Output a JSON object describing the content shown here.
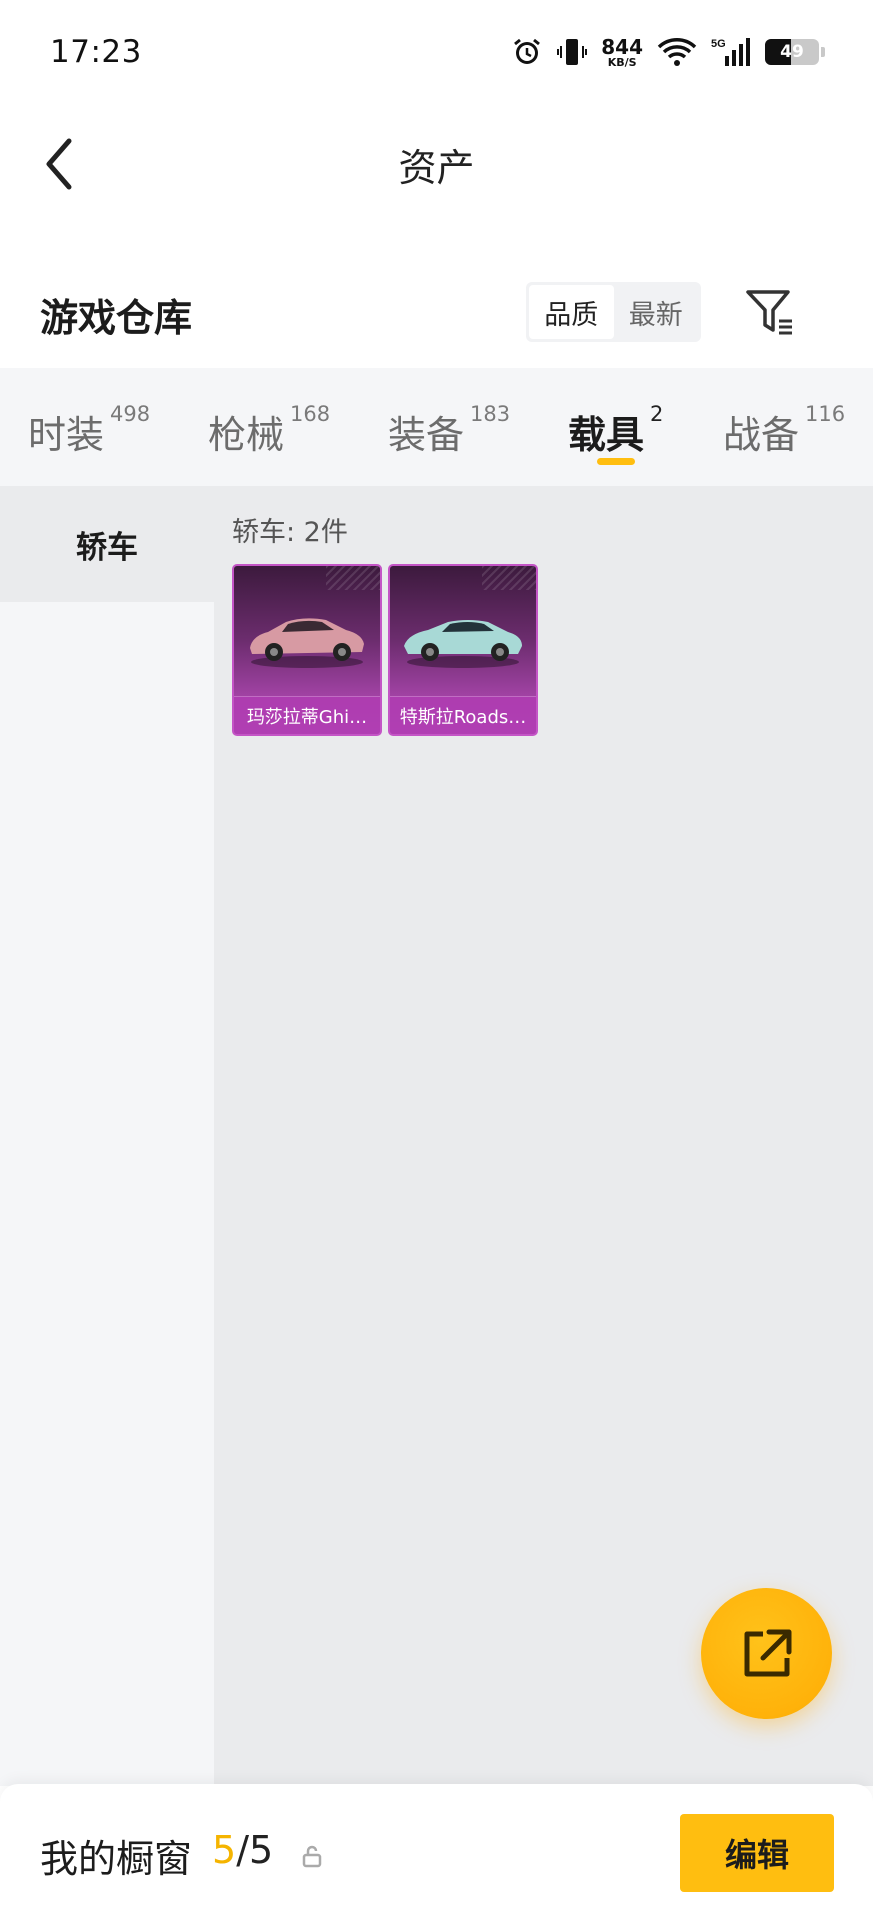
{
  "status_bar": {
    "time": "17:23",
    "net_speed": "844",
    "net_unit": "KB/S",
    "signal_label": "5G",
    "battery": 49,
    "battery_label": "49"
  },
  "header": {
    "title": "资产"
  },
  "warehouse": {
    "title": "游戏仓库",
    "sort_options": [
      {
        "label": "品质",
        "active": true
      },
      {
        "label": "最新",
        "active": false
      }
    ]
  },
  "tabs": [
    {
      "label": "时装",
      "count": "498",
      "active": false
    },
    {
      "label": "枪械",
      "count": "168",
      "active": false
    },
    {
      "label": "装备",
      "count": "183",
      "active": false
    },
    {
      "label": "载具",
      "count": "2",
      "active": true
    },
    {
      "label": "战备",
      "count": "116",
      "active": false
    }
  ],
  "sidebar": {
    "items": [
      {
        "label": "轿车",
        "active": true
      }
    ]
  },
  "main": {
    "section_label": "轿车: 2件",
    "items": [
      {
        "name": "玛莎拉蒂Ghi…",
        "car_color": "#d79aa3"
      },
      {
        "name": "特斯拉Roads…",
        "car_color": "#a8d9d6"
      }
    ]
  },
  "bottom_bar": {
    "label": "我的橱窗",
    "count_current": "5",
    "count_sep": "/",
    "count_max": "5",
    "edit_label": "编辑"
  },
  "colors": {
    "accent": "#ffbe10",
    "item_purple": "#a544a8",
    "tab_bg": "#f5f6f8",
    "main_bg": "#eaebed"
  }
}
